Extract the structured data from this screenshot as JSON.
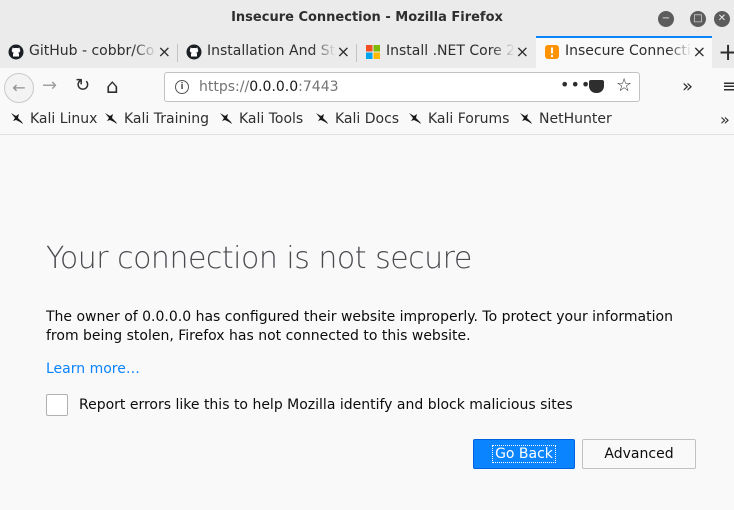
{
  "window": {
    "title": "Insecure Connection - Mozilla Firefox",
    "controls": [
      "−",
      "□",
      "✕"
    ]
  },
  "tabs": [
    {
      "label": "GitHub - cobbr/Co",
      "icon": "github-icon",
      "active": false
    },
    {
      "label": "Installation And St",
      "icon": "github-icon",
      "active": false
    },
    {
      "label": "Install .NET Core 2",
      "icon": "microsoft-icon",
      "active": false
    },
    {
      "label": "Insecure Connecti",
      "icon": "warning-icon",
      "active": true
    }
  ],
  "tab_close": "×",
  "new_tab": "+",
  "nav": {
    "back": "←",
    "forward": "→",
    "reload": "↻",
    "home": "⌂",
    "overflow": "»",
    "menu": "≡"
  },
  "urlbar": {
    "scheme": "https://",
    "host": "0.0.0.0",
    "port": ":7443",
    "page_actions": "•••"
  },
  "bookmarks": [
    "Kali Linux",
    "Kali Training",
    "Kali Tools",
    "Kali Docs",
    "Kali Forums",
    "NetHunter"
  ],
  "bookmarks_overflow": "»",
  "error_page": {
    "title": "Your connection is not secure",
    "description": "The owner of 0.0.0.0 has configured their website improperly. To protect your information from being stolen, Firefox has not connected to this website.",
    "learn_more": "Learn more…",
    "report_checkbox_label": "Report errors like this to help Mozilla identify and block malicious sites",
    "report_checked": false,
    "go_back_button": "Go Back",
    "advanced_button": "Advanced"
  },
  "colors": {
    "accent": "#0a84ff",
    "chrome": "#ebebeb",
    "page_bg": "#f9f9fa"
  }
}
